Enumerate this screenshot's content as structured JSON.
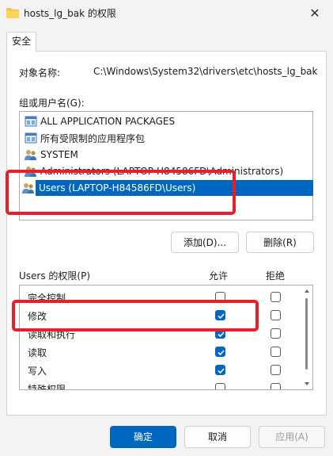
{
  "window": {
    "title": "hosts_lg_bak 的权限",
    "close_icon": "✕"
  },
  "tab": {
    "label": "安全"
  },
  "object": {
    "label": "对象名称:",
    "value": "C:\\Windows\\System32\\drivers\\etc\\hosts_lg_bak"
  },
  "groups": {
    "label": "组或用户名(G):",
    "items": [
      {
        "label": "ALL APPLICATION PACKAGES",
        "icon": "package-group-icon"
      },
      {
        "label": "所有受限制的应用程序包",
        "icon": "package-group-icon"
      },
      {
        "label": "SYSTEM",
        "icon": "users-icon"
      },
      {
        "label": "Administrators (LAPTOP-H84586FD\\Administrators)",
        "icon": "users-icon"
      },
      {
        "label": "Users (LAPTOP-H84586FD\\Users)",
        "icon": "users-icon",
        "selected": true
      }
    ]
  },
  "buttons": {
    "add": "添加(D)...",
    "remove": "删除(R)",
    "ok": "确定",
    "cancel": "取消",
    "apply": "应用(A)"
  },
  "permissions": {
    "title": "Users 的权限(P)",
    "allow_header": "允许",
    "deny_header": "拒绝",
    "rows": [
      {
        "name": "完全控制",
        "allow": false,
        "deny": false
      },
      {
        "name": "修改",
        "allow": true,
        "deny": false
      },
      {
        "name": "读取和执行",
        "allow": true,
        "deny": false
      },
      {
        "name": "读取",
        "allow": true,
        "deny": false
      },
      {
        "name": "写入",
        "allow": true,
        "deny": false
      },
      {
        "name": "特殊权限",
        "allow": false,
        "deny": false
      }
    ]
  },
  "colors": {
    "accent": "#0067c0",
    "highlight_box": "#e6202a"
  }
}
